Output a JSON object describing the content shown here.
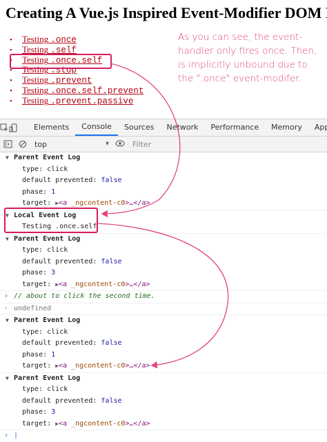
{
  "page": {
    "title": "Creating A Vue.js Inspired Event-Modifier DOM F"
  },
  "links": [
    {
      "pre": "Testing",
      "mod": ".once"
    },
    {
      "pre": "Testing",
      "mod": ".self"
    },
    {
      "pre": "Testing",
      "mod": ".once.self"
    },
    {
      "pre": "Testing",
      "mod": ".stop"
    },
    {
      "pre": "Testing",
      "mod": ".prevent"
    },
    {
      "pre": "Testing",
      "mod": ".once.self.prevent"
    },
    {
      "pre": "Testing",
      "mod": ".prevent.passive"
    }
  ],
  "annotation": "As you can see, the event-handler only fires once. Then, is implicitly unbound due to the \".once\" event-modifer.",
  "devtools": {
    "tabs": [
      "Elements",
      "Console",
      "Sources",
      "Network",
      "Performance",
      "Memory",
      "Applica"
    ],
    "active_tab": "Console",
    "context": "top",
    "filter_placeholder": "Filter"
  },
  "console": {
    "parent_label": "Parent Event Log",
    "local_label": "Local Event Log",
    "type_key": "type:",
    "type_val": "click",
    "default_key": "default prevented:",
    "default_val": "false",
    "phase_key": "phase:",
    "phase_1": "1",
    "phase_3": "3",
    "target_key": "target:",
    "target_tag_open": "<a",
    "target_attr": "_ngcontent-c0",
    "target_ellipsis": ">…</",
    "target_tag_close": "a>",
    "local_text": "Testing .once.self",
    "comment": "// about to click the second time.",
    "undefined": "undefined"
  },
  "colors": {
    "link": "#b3000f",
    "annotation": "#e0457b",
    "highlight": "#d81b5c",
    "active_tab": "#1a73e8"
  },
  "icons": [
    "inspect-icon",
    "device-icon",
    "panel-toggle-icon",
    "clear-console-icon",
    "eye-icon",
    "dropdown-icon",
    "expand-triangle-icon"
  ]
}
